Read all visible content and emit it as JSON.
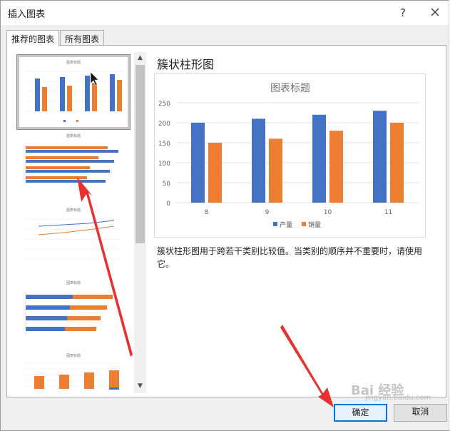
{
  "dialog": {
    "title": "插入图表",
    "help_label": "?",
    "tabs": [
      {
        "label": "推荐的图表",
        "active": true
      },
      {
        "label": "所有图表",
        "active": false
      }
    ]
  },
  "thumbnails": [
    {
      "name": "clustered-column",
      "title": "图表标题",
      "selected": true
    },
    {
      "name": "clustered-bar",
      "title": "图表标题",
      "selected": false
    },
    {
      "name": "line",
      "title": "图表标题",
      "selected": false
    },
    {
      "name": "stacked-bar",
      "title": "图表标题",
      "selected": false
    },
    {
      "name": "stacked-column",
      "title": "图表标题",
      "selected": false
    }
  ],
  "preview": {
    "heading": "簇状柱形图",
    "description": "簇状柱形图用于跨若干类别比较值。当类别的顺序并不重要时，请使用它。"
  },
  "chart_data": {
    "type": "bar",
    "title": "图表标题",
    "categories": [
      "8",
      "9",
      "10",
      "11"
    ],
    "series": [
      {
        "name": "产量",
        "values": [
          200,
          210,
          220,
          230
        ],
        "color": "#4472c4"
      },
      {
        "name": "销量",
        "values": [
          150,
          160,
          180,
          200
        ],
        "color": "#ed7d31"
      }
    ],
    "ylim": [
      0,
      250
    ],
    "yticks": [
      "0",
      "50",
      "100",
      "150",
      "200",
      "250"
    ],
    "grid": true,
    "legend": "bottom"
  },
  "buttons": {
    "ok": "确定",
    "cancel": "取消"
  },
  "watermark": {
    "text": "Bai 经验",
    "sub": "jingyan.baidu.com"
  },
  "colors": {
    "accent": "#0078d7",
    "annotation_arrow": "#e8302f"
  }
}
